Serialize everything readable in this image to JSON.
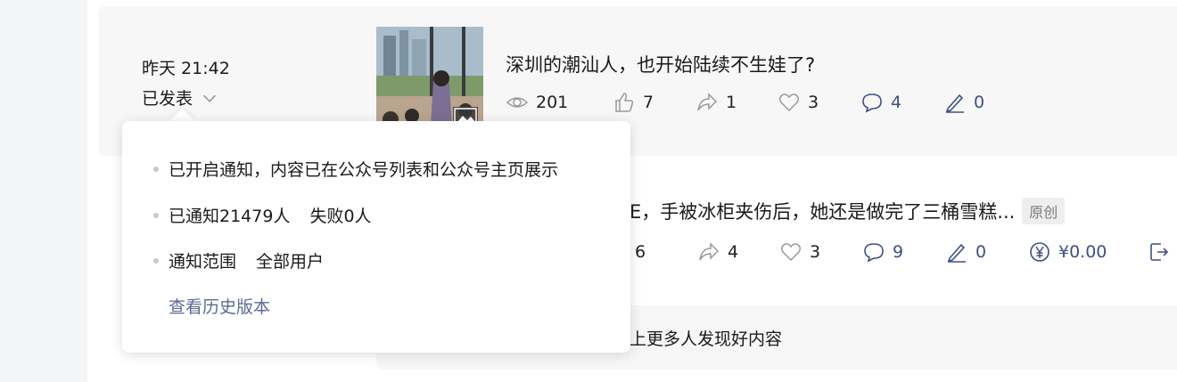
{
  "article1": {
    "time": "昨天 21:42",
    "status": "已发表",
    "title": "深圳的潮汕人，也开始陆续不生娃了?",
    "stats": {
      "views": "201",
      "likes": "7",
      "shares": "1",
      "favorites": "3",
      "comments": "4",
      "notes": "0"
    }
  },
  "article2": {
    "title_visible": "E，手被冰柜夹伤后，她还是做完了三桶雪糕...",
    "badge": "原创",
    "stats": {
      "likes": "6",
      "shares": "4",
      "favorites": "3",
      "comments": "9",
      "notes": "0",
      "reward": "¥0.00"
    }
  },
  "promo": {
    "text": "上更多人发现好内容"
  },
  "popover": {
    "line1": "已开启通知，内容已在公众号列表和公众号主页展示",
    "line2_label": "已通知21479人",
    "line2_fail": "失败0人",
    "line3_label": "通知范围",
    "line3_value": "全部用户",
    "history_link": "查看历史版本"
  },
  "colors": {
    "link": "#576b95",
    "stat_blue": "#3e4f87",
    "card_bg": "#f7f7f7"
  },
  "icons": [
    "eye-icon",
    "thumbs-up-icon",
    "share-icon",
    "heart-icon",
    "comment-icon",
    "pen-icon",
    "yen-icon",
    "export-icon",
    "chevron-down-icon",
    "image-icon"
  ]
}
